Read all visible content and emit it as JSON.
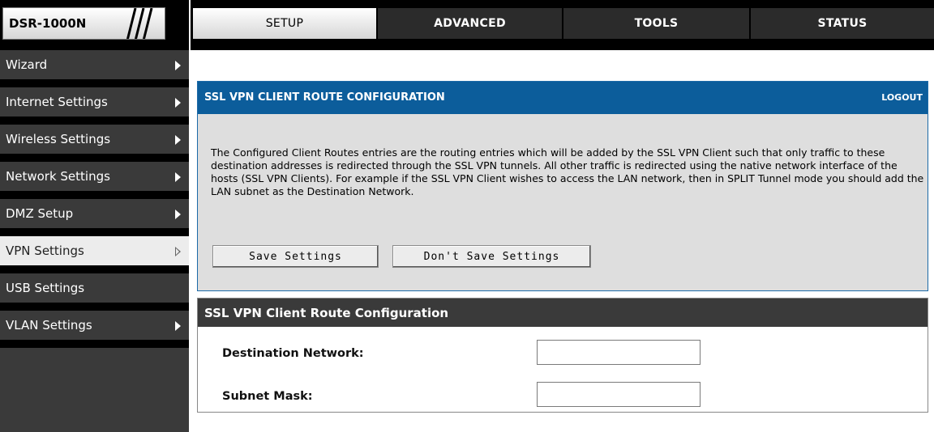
{
  "logo": {
    "text": "DSR-1000N"
  },
  "tabs": [
    {
      "label": "SETUP",
      "active": true
    },
    {
      "label": "ADVANCED",
      "active": false
    },
    {
      "label": "TOOLS",
      "active": false
    },
    {
      "label": "STATUS",
      "active": false
    }
  ],
  "sidebar": {
    "items": [
      {
        "label": "Wizard"
      },
      {
        "label": "Internet Settings"
      },
      {
        "label": "Wireless Settings"
      },
      {
        "label": "Network Settings"
      },
      {
        "label": "DMZ Setup"
      },
      {
        "label": "VPN Settings",
        "active": true
      },
      {
        "label": "USB Settings"
      },
      {
        "label": "VLAN Settings"
      }
    ]
  },
  "info_panel": {
    "title": "SSL VPN CLIENT ROUTE CONFIGURATION",
    "logout": "LOGOUT",
    "description": "The Configured Client Routes entries are the routing entries which will be added by the SSL VPN Client such that only traffic to these destination addresses is redirected through the SSL VPN tunnels. All other traffic is redirected using the native network interface of the hosts (SSL VPN Clients). For example if the SSL VPN Client wishes to access the LAN network, then in SPLIT Tunnel mode you should add the LAN subnet as the Destination Network.",
    "save_label": "Save Settings",
    "dont_save_label": "Don't Save Settings"
  },
  "form": {
    "title": "SSL VPN Client Route Configuration",
    "destination_label": "Destination Network:",
    "destination_value": "",
    "subnet_label": "Subnet Mask:",
    "subnet_value": ""
  },
  "colors": {
    "panel_header": "#0c5d9b",
    "sidebar_bg": "#3a3a3a",
    "panel_bg": "#dedede"
  }
}
